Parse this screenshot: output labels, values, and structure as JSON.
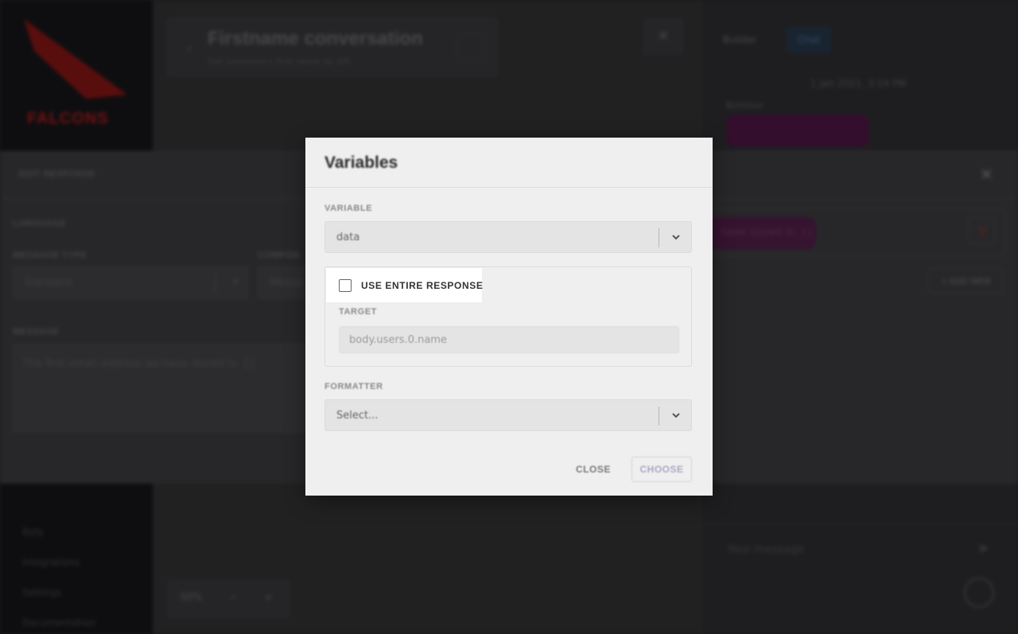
{
  "background": {
    "logo_text": "FALCONS",
    "conversation": {
      "title": "Firstname conversation",
      "subtitle": "Get someone's first name by API"
    },
    "zoom": {
      "level": "50%",
      "minus": "−",
      "plus": "+"
    },
    "sidebar": {
      "items": [
        "Bots",
        "Integrations",
        "Settings",
        "Documentation"
      ]
    },
    "right_panel": {
      "tabs": [
        "Builder",
        "Chat"
      ],
      "active_tab": "Chat",
      "date": "1 Jan 2021, 3:19 PM",
      "sender": "Bot/User",
      "message_placeholder": "Your message"
    },
    "edit_response": {
      "header": "EDIT RESPONSE",
      "language_label": "LANGUAGE",
      "message_type_label": "MESSAGE TYPE",
      "message_type_value": "Standard",
      "component_label": "COMPON",
      "component_value": "Messa",
      "message_label": "MESSAGE",
      "message_value": "The first email address we have stored is: {}",
      "chip_text": "have stored is: {}",
      "add_new": "+ ADD NEW"
    }
  },
  "modal": {
    "title": "Variables",
    "variable_label": "VARIABLE",
    "variable_value": "data",
    "use_entire_response_label": "USE ENTIRE RESPONSE",
    "use_entire_response_checked": false,
    "target_label": "TARGET",
    "target_placeholder": "body.users.0.name",
    "formatter_label": "FORMATTER",
    "formatter_placeholder": "Select...",
    "close_label": "CLOSE",
    "choose_label": "CHOOSE"
  },
  "colors": {
    "modal_bg": "#efefef",
    "highlight_bg": "#ffffff",
    "brand_red": "#8a1414",
    "choose_accent": "#a8a8c4"
  }
}
